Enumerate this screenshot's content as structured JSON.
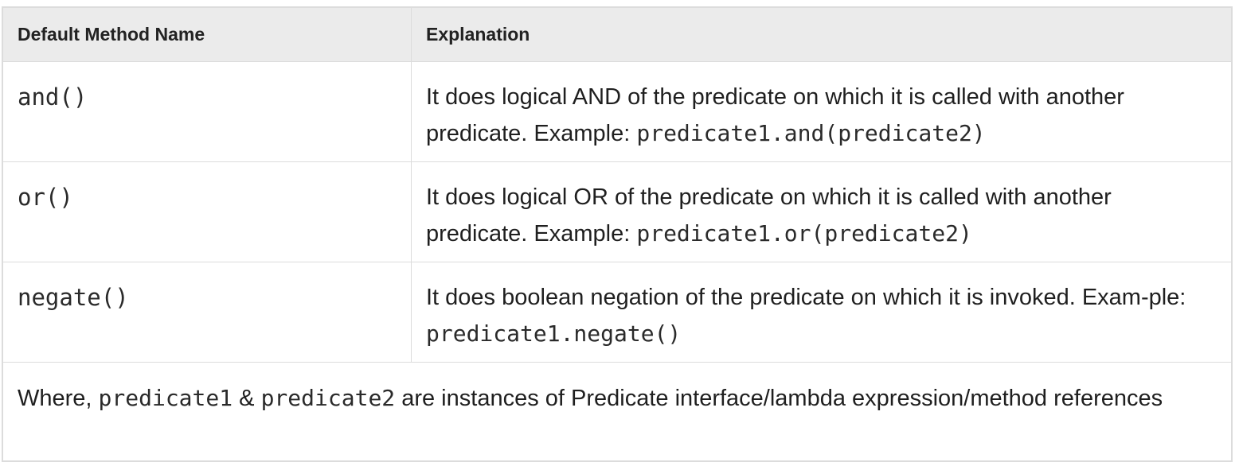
{
  "table": {
    "headers": [
      "Default Method Name",
      "Explanation"
    ],
    "rows": [
      {
        "method": "and()",
        "text_before": "It does logical AND of the predicate on which it is called with another predicate. Example: ",
        "code": "predicate1.and(predicate2)"
      },
      {
        "method": "or()",
        "text_before": "It does logical OR of the predicate on which it is called with another predicate. Example: ",
        "code": "predicate1.or(predicate2)"
      },
      {
        "method": "negate()",
        "text_before": "It does boolean negation of the predicate on which it is invoked. Exam-ple: ",
        "code": "predicate1.negate()"
      }
    ],
    "footer": {
      "prefix": "Where, ",
      "code1": "predicate1",
      "joiner": " & ",
      "code2": "predicate2",
      "suffix": " are instances of Predicate interface/lambda expression/method references"
    }
  }
}
